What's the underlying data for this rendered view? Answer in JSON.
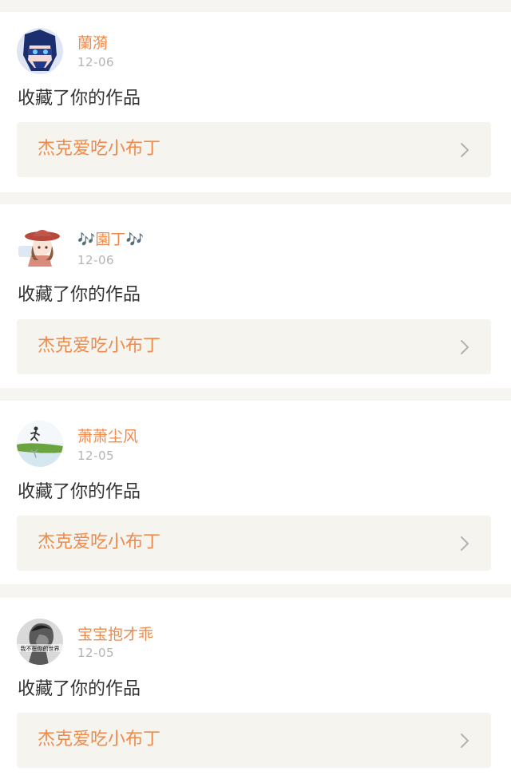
{
  "notifications": [
    {
      "avatar_icon": "masked-anime-avatar",
      "name_prefix": "",
      "username": "蘭漪",
      "name_suffix": "",
      "date": "12-06",
      "action": "收藏了你的作品",
      "work_title": "杰克爱吃小布丁"
    },
    {
      "avatar_icon": "hat-girl-avatar",
      "name_prefix": "🎶",
      "username": "園丁",
      "name_suffix": "🎶",
      "date": "12-06",
      "action": "收藏了你的作品",
      "work_title": "杰克爱吃小布丁"
    },
    {
      "avatar_icon": "runner-landscape-avatar",
      "name_prefix": "",
      "username": "萧萧尘风",
      "name_suffix": "",
      "date": "12-05",
      "action": "收藏了你的作品",
      "work_title": "杰克爱吃小布丁"
    },
    {
      "avatar_icon": "bw-portrait-avatar",
      "avatar_caption": "我不在你的世界",
      "name_prefix": "",
      "username": "宝宝抱才乖",
      "name_suffix": "",
      "date": "12-05",
      "action": "收藏了你的作品",
      "work_title": "杰克爱吃小布丁"
    }
  ],
  "colors": {
    "accent": "#ef8a4a",
    "date": "#b4b4b4",
    "text": "#333333",
    "link_background": "#f6f4ee",
    "separator": "#f7f5f2"
  }
}
